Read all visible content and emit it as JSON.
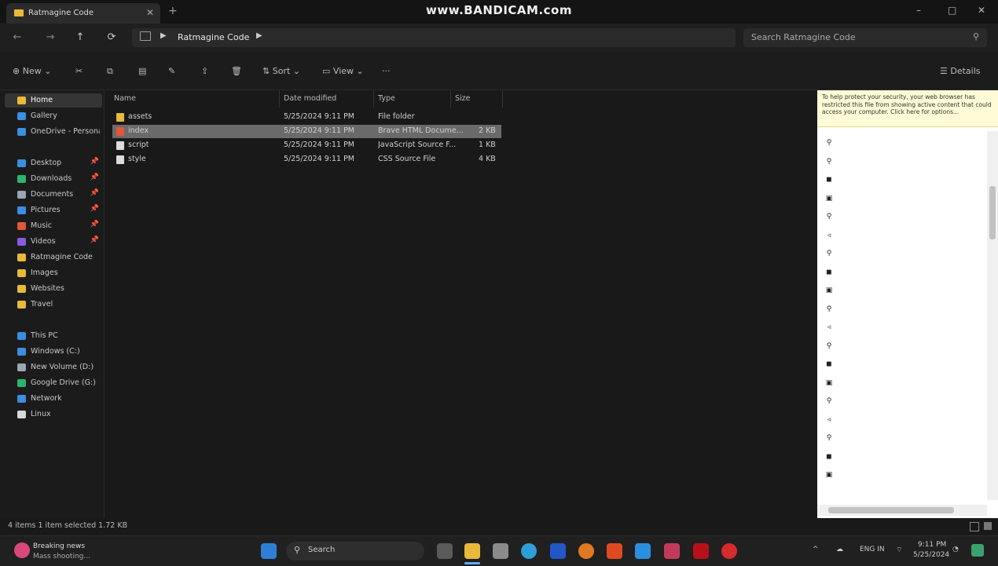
{
  "window": {
    "tab_title": "Ratmagine Code",
    "new_tab": "+",
    "watermark": "www.BANDICAM.com",
    "controls": [
      "–",
      "□",
      "✕"
    ]
  },
  "nav": {
    "back": "←",
    "forward": "→",
    "up": "↑",
    "refresh": "⟳",
    "breadcrumb": "Ratmagine Code",
    "search_placeholder": "Search Ratmagine Code"
  },
  "toolbar": {
    "new": "New",
    "sort": "Sort",
    "view": "View",
    "more": "···",
    "details": "Details"
  },
  "sidebar": {
    "items": [
      {
        "label": "Home",
        "icon": "home-icon",
        "color": "#e8b93a",
        "pinned": false,
        "selected": true
      },
      {
        "label": "Gallery",
        "icon": "gallery-icon",
        "color": "#3b8ee0",
        "pinned": false
      },
      {
        "label": "OneDrive - Personal",
        "icon": "cloud-icon",
        "color": "#3b8ee0",
        "pinned": false
      },
      {
        "label": "Desktop",
        "icon": "desktop-icon",
        "color": "#3b8ee0",
        "pinned": true
      },
      {
        "label": "Downloads",
        "icon": "download-icon",
        "color": "#2db46f",
        "pinned": true
      },
      {
        "label": "Documents",
        "icon": "document-icon",
        "color": "#9aa6b2",
        "pinned": true
      },
      {
        "label": "Pictures",
        "icon": "pictures-icon",
        "color": "#3b8ee0",
        "pinned": true
      },
      {
        "label": "Music",
        "icon": "music-icon",
        "color": "#e0573b",
        "pinned": true
      },
      {
        "label": "Videos",
        "icon": "videos-icon",
        "color": "#8a5ae0",
        "pinned": true
      },
      {
        "label": "Ratmagine Code",
        "icon": "folder-icon",
        "color": "#e8b93a",
        "pinned": false
      },
      {
        "label": "Images",
        "icon": "folder-icon",
        "color": "#e8b93a",
        "pinned": false
      },
      {
        "label": "Websites",
        "icon": "folder-icon",
        "color": "#e8b93a",
        "pinned": false
      },
      {
        "label": "Travel",
        "icon": "folder-icon",
        "color": "#e8b93a",
        "pinned": false
      },
      {
        "label": "This PC",
        "icon": "pc-icon",
        "color": "#3b8ee0",
        "pinned": false
      },
      {
        "label": "Windows (C:)",
        "icon": "drive-icon",
        "color": "#3b8ee0",
        "pinned": false
      },
      {
        "label": "New Volume (D:)",
        "icon": "drive-icon",
        "color": "#9aa6b2",
        "pinned": false
      },
      {
        "label": "Google Drive (G:)",
        "icon": "drive-icon",
        "color": "#2db46f",
        "pinned": false
      },
      {
        "label": "Network",
        "icon": "network-icon",
        "color": "#3b8ee0",
        "pinned": false
      },
      {
        "label": "Linux",
        "icon": "linux-icon",
        "color": "#d8d8d8",
        "pinned": false
      }
    ]
  },
  "files": {
    "columns": [
      "Name",
      "Date modified",
      "Type",
      "Size"
    ],
    "rows": [
      {
        "name": "assets",
        "date": "5/25/2024 9:11 PM",
        "type": "File folder",
        "size": "",
        "icon_color": "#e8b93a",
        "selected": false
      },
      {
        "name": "index",
        "date": "5/25/2024 9:11 PM",
        "type": "Brave HTML Docume...",
        "size": "2 KB",
        "icon_color": "#e0573b",
        "selected": true
      },
      {
        "name": "script",
        "date": "5/25/2024 9:11 PM",
        "type": "JavaScript Source F...",
        "size": "1 KB",
        "icon_color": "#dcdcdc",
        "selected": false
      },
      {
        "name": "style",
        "date": "5/25/2024 9:11 PM",
        "type": "CSS Source File",
        "size": "4 KB",
        "icon_color": "#dcdcdc",
        "selected": false
      }
    ]
  },
  "preview": {
    "infobar": "To help protect your security, your web browser has restricted this file from showing active content that could access your computer. Click here for options..."
  },
  "status": {
    "text": "4 items   1 item selected  1.72 KB"
  },
  "taskbar": {
    "weather_line1": "Breaking news",
    "weather_line2": "Mass shooting...",
    "search_label": "Search",
    "tray_chevron": "^",
    "tray_lang": "ENG IN",
    "tray_time": "9:11 PM",
    "tray_date": "5/25/2024"
  }
}
